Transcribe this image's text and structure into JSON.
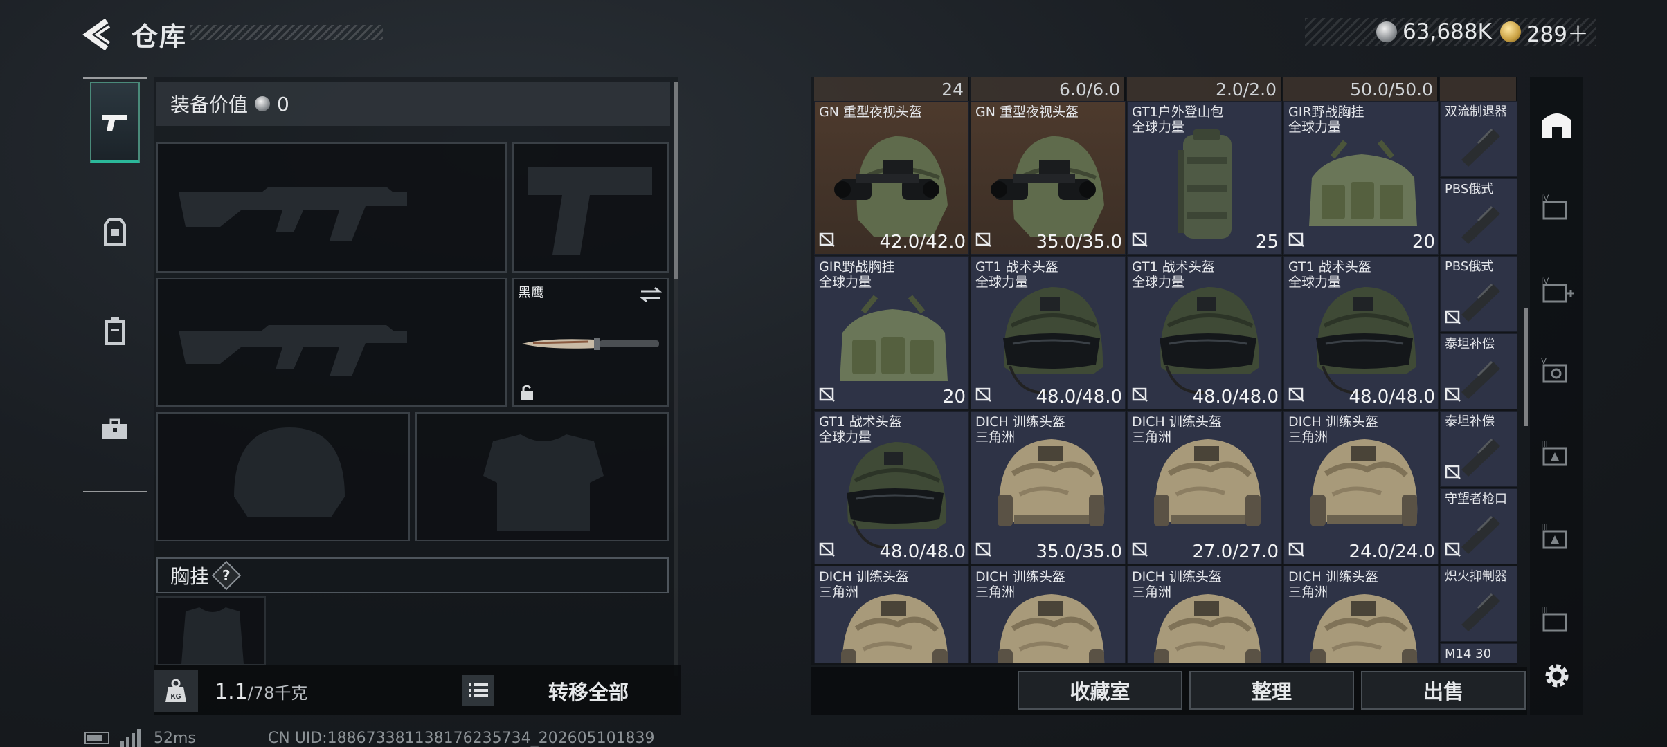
{
  "header": {
    "title": "仓库",
    "silver_amount": "63,688K",
    "gold_amount": "289＋"
  },
  "equipment": {
    "value_label": "装备价值",
    "value": "0",
    "knife_name": "黑鹰",
    "chest_label": "胸挂",
    "chest_help": "?"
  },
  "footer_left": {
    "kg_label": "KG",
    "weight": "1.1",
    "weight_max": "/78千克",
    "transfer_label": "转移全部"
  },
  "inventory": {
    "top_strip": [
      {
        "text": "24"
      },
      {
        "text": "6.0/6.0"
      },
      {
        "text": "2.0/2.0"
      },
      {
        "text": "50.0/50.0"
      }
    ],
    "rows": [
      [
        {
          "name": "GN 重型夜视头盔",
          "sub": "",
          "value": "42.0/42.0",
          "kind": "nvg"
        },
        {
          "name": "GN 重型夜视头盔",
          "sub": "",
          "value": "35.0/35.0",
          "kind": "nvg"
        },
        {
          "name": "GT1户外登山包",
          "sub": "全球力量",
          "value": "25",
          "kind": "backpack"
        },
        {
          "name": "GIR野战胸挂",
          "sub": "全球力量",
          "value": "20",
          "kind": "rig"
        }
      ],
      [
        {
          "name": "GIR野战胸挂",
          "sub": "全球力量",
          "value": "20",
          "kind": "rig"
        },
        {
          "name": "GT1 战术头盔",
          "sub": "全球力量",
          "value": "48.0/48.0",
          "kind": "green"
        },
        {
          "name": "GT1 战术头盔",
          "sub": "全球力量",
          "value": "48.0/48.0",
          "kind": "green"
        },
        {
          "name": "GT1 战术头盔",
          "sub": "全球力量",
          "value": "48.0/48.0",
          "kind": "green"
        }
      ],
      [
        {
          "name": "GT1 战术头盔",
          "sub": "全球力量",
          "value": "48.0/48.0",
          "kind": "green"
        },
        {
          "name": "DICH 训练头盔",
          "sub": "三角洲",
          "value": "35.0/35.0",
          "kind": "tan"
        },
        {
          "name": "DICH 训练头盔",
          "sub": "三角洲",
          "value": "27.0/27.0",
          "kind": "tan"
        },
        {
          "name": "DICH 训练头盔",
          "sub": "三角洲",
          "value": "24.0/24.0",
          "kind": "tan"
        }
      ],
      [
        {
          "name": "DICH 训练头盔",
          "sub": "三角洲",
          "value": "",
          "kind": "tan"
        },
        {
          "name": "DICH 训练头盔",
          "sub": "三角洲",
          "value": "",
          "kind": "tan"
        },
        {
          "name": "DICH 训练头盔",
          "sub": "三角洲",
          "value": "",
          "kind": "tan"
        },
        {
          "name": "DICH 训练头盔",
          "sub": "三角洲",
          "value": "",
          "kind": "tan"
        }
      ]
    ],
    "side_items": [
      {
        "name": "双流制退器"
      },
      {
        "name": "PBS俄式"
      },
      {
        "name": "PBS俄式"
      },
      {
        "name": "泰坦补偿"
      },
      {
        "name": "泰坦补偿"
      },
      {
        "name": "守望者枪口"
      },
      {
        "name": "炽火抑制器"
      },
      {
        "name": "M14 30"
      }
    ]
  },
  "actions": {
    "collection": "收藏室",
    "sort": "整理",
    "sell": "出售"
  },
  "status": {
    "ping": "52ms",
    "uid": "CN UID:1886733811381762357​34_202605101839"
  }
}
